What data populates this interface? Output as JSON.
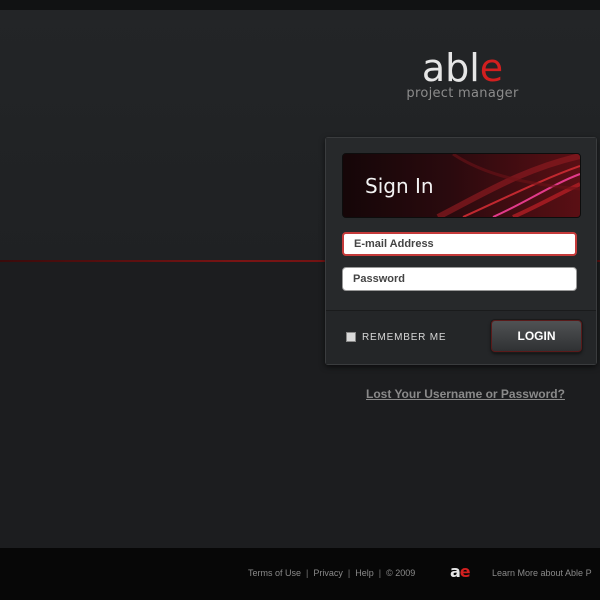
{
  "header": {
    "logo_prefix": "abl",
    "logo_accent": "e",
    "logo_subtitle": "project manager"
  },
  "login": {
    "title": "Sign In",
    "email_placeholder": "E-mail Address",
    "password_placeholder": "Password",
    "remember_label": "REMEMBER ME",
    "login_button": "LOGIN",
    "lost_link": "Lost Your Username or Password?"
  },
  "footer": {
    "links": [
      "Terms of Use",
      "Privacy",
      "Help"
    ],
    "copyright": "© 2009",
    "ae_logo_prefix": "a",
    "ae_logo_accent": "e",
    "learn_more": "Learn More about Able P"
  },
  "colors": {
    "accent": "#d21f1f",
    "background": "#1d1f21"
  }
}
